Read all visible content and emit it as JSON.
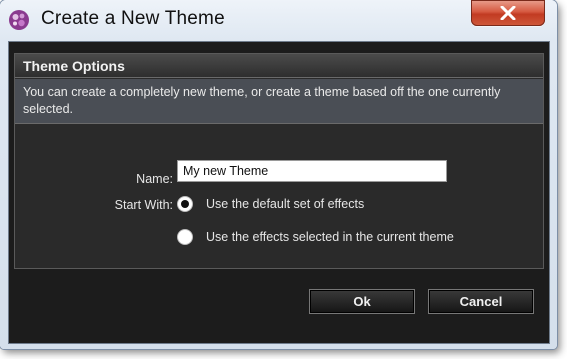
{
  "window": {
    "title": "Create a New Theme",
    "icon": "app-icon",
    "close_icon": "close-icon"
  },
  "panel": {
    "header": "Theme Options",
    "description": "You can create a completely new theme, or create a theme based off the one currently selected."
  },
  "form": {
    "name_label": "Name:",
    "name_value": "My new Theme",
    "start_label": "Start With:",
    "options": [
      {
        "label": "Use the default set of effects",
        "selected": true
      },
      {
        "label": "Use the effects selected in the current theme",
        "selected": false
      }
    ]
  },
  "buttons": {
    "ok": "Ok",
    "cancel": "Cancel"
  }
}
